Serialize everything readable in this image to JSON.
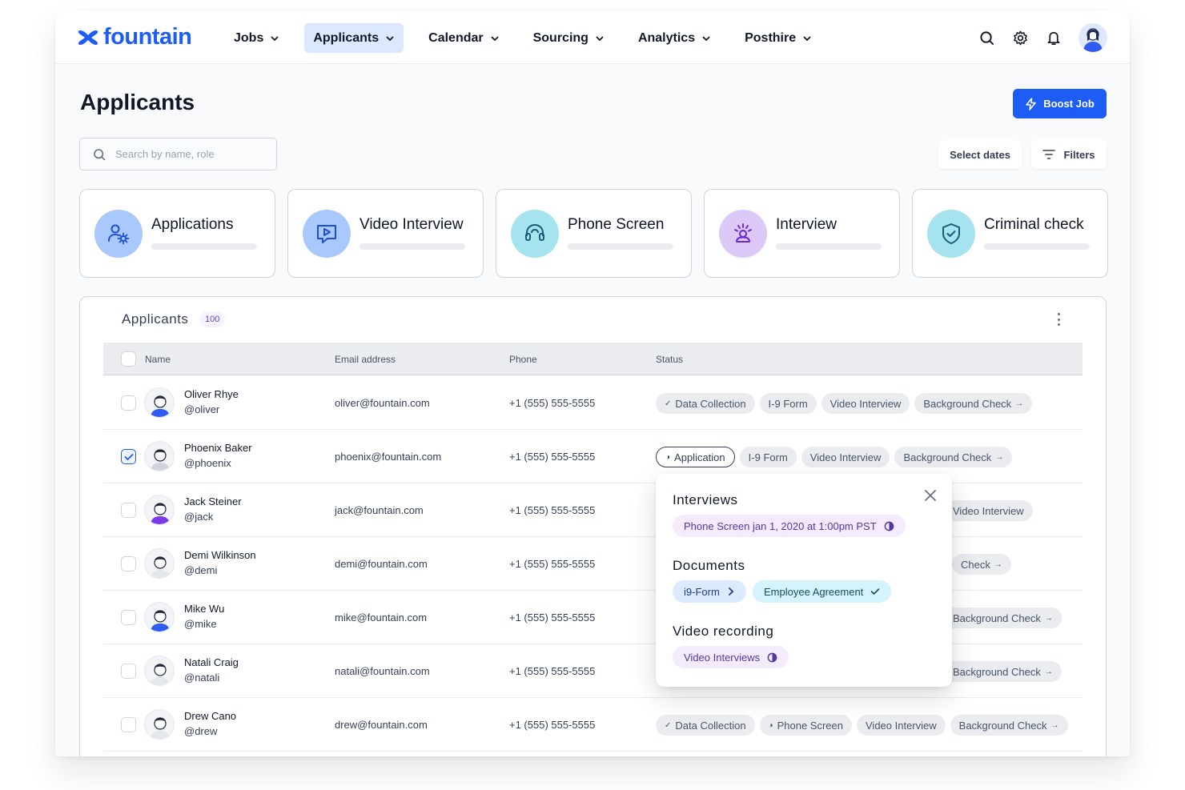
{
  "app": {
    "logo_text": "fountain"
  },
  "nav": [
    {
      "label": "Jobs",
      "active": false
    },
    {
      "label": "Applicants",
      "active": true
    },
    {
      "label": "Calendar",
      "active": false
    },
    {
      "label": "Sourcing",
      "active": false
    },
    {
      "label": "Analytics",
      "active": false
    },
    {
      "label": "Posthire",
      "active": false
    }
  ],
  "header": {
    "title": "Applicants",
    "boost_label": "Boost Job",
    "search_placeholder": "Search by name, role",
    "dates_label": "Select dates",
    "filters_label": "Filters"
  },
  "stages": [
    {
      "label": "Applications",
      "color": "#a9c8fb",
      "icon": "users-gear-icon"
    },
    {
      "label": "Video Interview",
      "color": "#a9c8fb",
      "icon": "video-play-icon"
    },
    {
      "label": "Phone Screen",
      "color": "#a5e3ee",
      "icon": "headset-icon"
    },
    {
      "label": "Interview",
      "color": "#dcc9f8",
      "icon": "interview-person-icon"
    },
    {
      "label": "Criminal check",
      "color": "#a5e3ee",
      "icon": "shield-check-icon"
    }
  ],
  "table": {
    "title": "Applicants",
    "count": "100",
    "columns": {
      "name": "Name",
      "email": "Email address",
      "phone": "Phone",
      "status": "Status"
    },
    "rows": [
      {
        "name": "Oliver Rhye",
        "handle": "@oliver",
        "email": "oliver@fountain.com",
        "phone": "+1 (555) 555-5555",
        "checked": false,
        "statuses": [
          {
            "label": "Data Collection",
            "prefix": "✓"
          },
          {
            "label": "I-9 Form"
          },
          {
            "label": "Video Interview"
          },
          {
            "label": "Background Check",
            "suffix": "→"
          }
        ]
      },
      {
        "name": "Phoenix Baker",
        "handle": "@phoenix",
        "email": "phoenix@fountain.com",
        "phone": "+1 (555) 555-5555",
        "checked": true,
        "statuses": [
          {
            "label": "Application",
            "prefix": "◑",
            "outline": true
          },
          {
            "label": "I-9 Form"
          },
          {
            "label": "Video Interview"
          },
          {
            "label": "Background Check",
            "suffix": "→"
          }
        ]
      },
      {
        "name": "Jack Steiner",
        "handle": "@jack",
        "email": "jack@fountain.com",
        "phone": "+1 (555) 555-5555",
        "checked": false,
        "statuses": [
          {
            "label": "Video Interview"
          }
        ]
      },
      {
        "name": "Demi Wilkinson",
        "handle": "@demi",
        "email": "demi@fountain.com",
        "phone": "+1 (555) 555-5555",
        "checked": false,
        "statuses": [
          {
            "label": "Check",
            "suffix": "→"
          }
        ]
      },
      {
        "name": "Mike Wu",
        "handle": "@mike",
        "email": "mike@fountain.com",
        "phone": "+1 (555) 555-5555",
        "checked": false,
        "statuses": [
          {
            "label": "Background Check",
            "suffix": "→"
          }
        ]
      },
      {
        "name": "Natali Craig",
        "handle": "@natali",
        "email": "natali@fountain.com",
        "phone": "+1 (555) 555-5555",
        "checked": false,
        "statuses": [
          {
            "label": "Background Check",
            "suffix": "→"
          }
        ]
      },
      {
        "name": "Drew Cano",
        "handle": "@drew",
        "email": "drew@fountain.com",
        "phone": "+1 (555) 555-5555",
        "checked": false,
        "statuses": [
          {
            "label": "Data Collection",
            "prefix": "✓"
          },
          {
            "label": "Phone Screen",
            "prefix": "◑"
          },
          {
            "label": "Video Interview"
          },
          {
            "label": "Background Check",
            "suffix": "→"
          }
        ]
      }
    ]
  },
  "popover": {
    "interviews_heading": "Interviews",
    "interview_chip": "Phone Screen jan 1, 2020 at 1:00pm PST",
    "documents_heading": "Documents",
    "doc_chip_1": "i9-Form",
    "doc_chip_2": "Employee Agreement",
    "video_heading": "Video recording",
    "video_chip": "Video Interviews"
  }
}
